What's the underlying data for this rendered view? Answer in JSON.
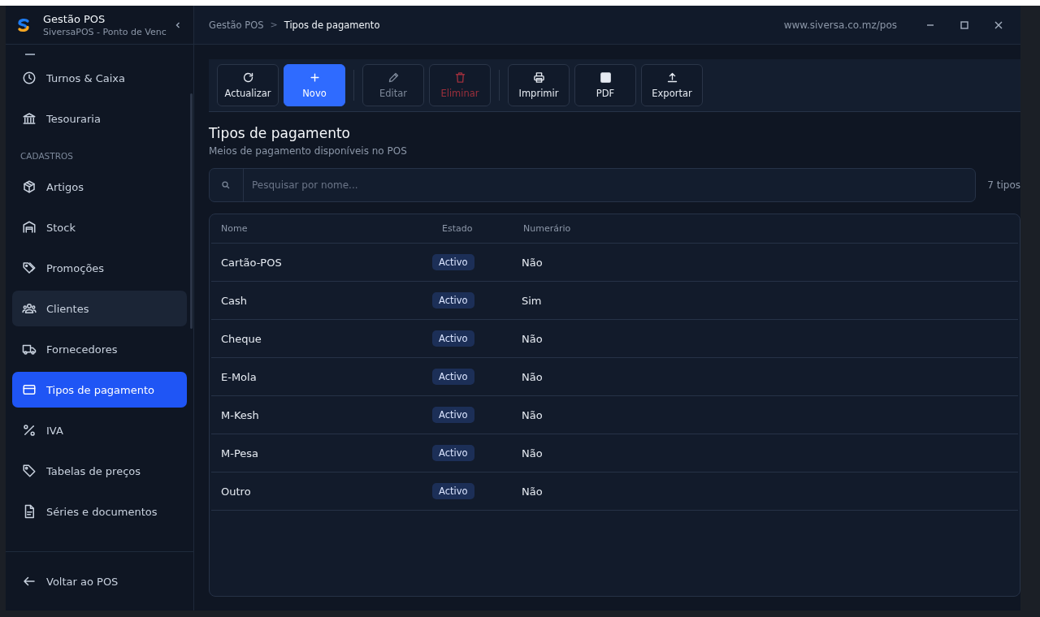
{
  "app": {
    "title": "Gestão POS",
    "subtitle": "SiversaPOS - Ponto de Venc"
  },
  "sidebar": {
    "items": [
      {
        "label": "Turnos & Caixa",
        "selected": false,
        "hovered": false
      },
      {
        "label": "Tesouraria",
        "selected": false,
        "hovered": false
      }
    ],
    "section": "CADASTROS",
    "section_items": [
      {
        "label": "Artigos",
        "selected": false,
        "hovered": false
      },
      {
        "label": "Stock",
        "selected": false,
        "hovered": false
      },
      {
        "label": "Promoções",
        "selected": false,
        "hovered": false
      },
      {
        "label": "Clientes",
        "selected": false,
        "hovered": true
      },
      {
        "label": "Fornecedores",
        "selected": false,
        "hovered": false
      },
      {
        "label": "Tipos de pagamento",
        "selected": true,
        "hovered": false
      },
      {
        "label": "IVA",
        "selected": false,
        "hovered": false
      },
      {
        "label": "Tabelas de preços",
        "selected": false,
        "hovered": false
      },
      {
        "label": "Séries e documentos",
        "selected": false,
        "hovered": false
      }
    ],
    "footer": "Voltar ao POS"
  },
  "breadcrumb": [
    "Gestão POS",
    "Tipos de pagamento"
  ],
  "breadcrumb_separator": ">",
  "url": "www.siversa.co.mz/pos",
  "toolbar": [
    {
      "label": "Actualizar",
      "kind": "normal",
      "disabled": false
    },
    {
      "label": "Novo",
      "kind": "primary",
      "disabled": false
    },
    {
      "label": "Editar",
      "kind": "normal",
      "disabled": true
    },
    {
      "label": "Eliminar",
      "kind": "danger",
      "disabled": true
    },
    {
      "label": "Imprimir",
      "kind": "normal",
      "disabled": false
    },
    {
      "label": "PDF",
      "kind": "normal",
      "disabled": false
    },
    {
      "label": "Exportar",
      "kind": "normal",
      "disabled": false
    }
  ],
  "page": {
    "title": "Tipos de pagamento",
    "subtitle": "Meios de pagamento disponíveis no POS"
  },
  "search": {
    "placeholder": "Pesquisar por nome...",
    "count": "7 tipos"
  },
  "table": {
    "columns": [
      "Nome",
      "Estado",
      "Numerário"
    ],
    "rows": [
      {
        "name": "Cartão-POS",
        "status": "Activo",
        "cash": "Não"
      },
      {
        "name": "Cash",
        "status": "Activo",
        "cash": "Sim"
      },
      {
        "name": "Cheque",
        "status": "Activo",
        "cash": "Não"
      },
      {
        "name": "E-Mola",
        "status": "Activo",
        "cash": "Não"
      },
      {
        "name": "M-Kesh",
        "status": "Activo",
        "cash": "Não"
      },
      {
        "name": "M-Pesa",
        "status": "Activo",
        "cash": "Não"
      },
      {
        "name": "Outro",
        "status": "Activo",
        "cash": "Não"
      }
    ]
  }
}
